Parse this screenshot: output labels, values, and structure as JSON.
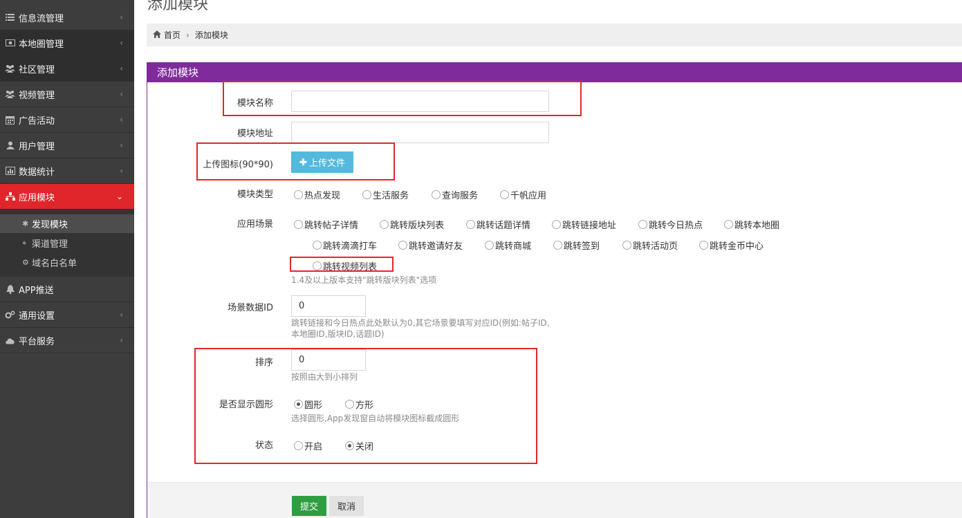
{
  "sidebar": {
    "items": [
      {
        "label": "信息流管理",
        "icon": "list-icon"
      },
      {
        "label": "本地圈管理",
        "icon": "image-icon"
      },
      {
        "label": "社区管理",
        "icon": "users-icon"
      },
      {
        "label": "视频管理",
        "icon": "users-icon"
      },
      {
        "label": "广告活动",
        "icon": "calendar-icon"
      },
      {
        "label": "用户管理",
        "icon": "user-icon"
      },
      {
        "label": "数据统计",
        "icon": "bar-chart-icon"
      },
      {
        "label": "应用模块",
        "icon": "sitemap-icon"
      },
      {
        "label": "APP推送",
        "icon": "bell-icon"
      },
      {
        "label": "通用设置",
        "icon": "gears-icon"
      },
      {
        "label": "平台服务",
        "icon": "cloud-icon"
      }
    ],
    "sub_items": [
      {
        "label": "发现模块",
        "icon": "asterisk-icon"
      },
      {
        "label": "渠道管理",
        "icon": "crosshair-icon"
      },
      {
        "label": "域名白名单",
        "icon": "gear-icon"
      }
    ]
  },
  "page": {
    "title": "添加模块",
    "breadcrumb": {
      "home": "首页",
      "current": "添加模块"
    },
    "panel_title": "添加模块"
  },
  "form": {
    "module_name_label": "模块名称",
    "module_name_value": "",
    "module_url_label": "模块地址",
    "module_url_value": "",
    "upload_label": "上传图标(90*90)",
    "upload_button": "上传文件",
    "type_label": "模块类型",
    "type_options": [
      "热点发现",
      "生活服务",
      "查询服务",
      "千帆应用"
    ],
    "scene_label": "应用场景",
    "scene_options": [
      "跳转帖子详情",
      "跳转版块列表",
      "跳转话题详情",
      "跳转链接地址",
      "跳转今日热点",
      "跳转本地圈",
      "跳转滴滴打车",
      "跳转邀请好友",
      "跳转商城",
      "跳转签到",
      "跳转活动页",
      "跳转金币中心",
      "跳转视频列表"
    ],
    "scene_hint": "1.4及以上版本支持\"跳转版块列表\"选项",
    "scene_data_label": "场景数据ID",
    "scene_data_value": "0",
    "scene_data_hint_1": "跳转链接和今日热点此处默认为0,其它场景要填写对应ID(例如:帖子ID,",
    "scene_data_hint_2": "本地圈ID,版块ID,话题ID)",
    "sort_label": "排序",
    "sort_value": "0",
    "sort_hint": "按照由大到小排列",
    "shape_label": "是否显示圆形",
    "shape_options": [
      "圆形",
      "方形"
    ],
    "shape_selected": "圆形",
    "shape_hint": "选择圆形,App发现窗自动将模块图标截成圆形",
    "status_label": "状态",
    "status_options": [
      "开启",
      "关闭"
    ],
    "status_selected": "关闭",
    "submit": "提交",
    "cancel": "取消"
  },
  "colors": {
    "sidebar_bg": "#3d3d3d",
    "active_red": "#e0262a",
    "panel_header": "#7f2b9b",
    "upload_btn": "#54b9dd",
    "submit_btn": "#2e9e41",
    "annotation_red": "#e3262a"
  }
}
